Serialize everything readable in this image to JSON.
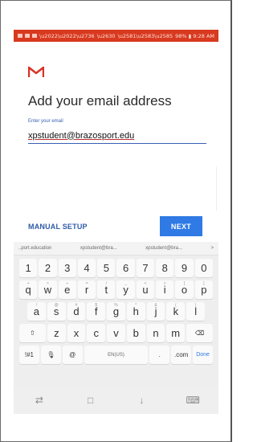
{
  "status_bar": {
    "left_text": "▣ ▢ ▤ ••",
    "right_text": "98% ▮ 9:28 AM",
    "color": "#d8391f"
  },
  "brand": {
    "icon": "gmail-icon",
    "color": "#d93025"
  },
  "title": "Add your email address",
  "email": {
    "label": "Enter your email",
    "value": "xpstudent@brazosport.edu"
  },
  "actions": {
    "manual_setup": "MANUAL SETUP",
    "next": "NEXT"
  },
  "keyboard": {
    "suggestions": [
      "..port.education",
      "xpstudent@bra...",
      "xpstudent@bra..."
    ],
    "suggestion_more": ">",
    "row_numbers": [
      "1",
      "2",
      "3",
      "4",
      "5",
      "6",
      "7",
      "8",
      "9",
      "0"
    ],
    "row_q": [
      {
        "k": "q",
        "s": "+"
      },
      {
        "k": "w",
        "s": "×"
      },
      {
        "k": "e",
        "s": "÷"
      },
      {
        "k": "r",
        "s": "="
      },
      {
        "k": "t",
        "s": "/"
      },
      {
        "k": "y",
        "s": "_"
      },
      {
        "k": "u",
        "s": "<"
      },
      {
        "k": "i",
        "s": ">"
      },
      {
        "k": "o",
        "s": "["
      },
      {
        "k": "p",
        "s": "]"
      }
    ],
    "row_a": [
      {
        "k": "a",
        "s": "!"
      },
      {
        "k": "s",
        "s": "@"
      },
      {
        "k": "d",
        "s": "#"
      },
      {
        "k": "f",
        "s": "$"
      },
      {
        "k": "g",
        "s": "%"
      },
      {
        "k": "h",
        "s": "^"
      },
      {
        "k": "j",
        "s": "&"
      },
      {
        "k": "k",
        "s": "("
      },
      {
        "k": "l",
        "s": ")"
      }
    ],
    "row_z": [
      "z",
      "x",
      "c",
      "v",
      "b",
      "n",
      "m"
    ],
    "shift": "⇧",
    "backspace": "⌫",
    "sym": "!#1",
    "mic": "🎙",
    "at": "@",
    "space": "EN(US)",
    "dot": ".",
    "dotcom": ".com",
    "done": "Done"
  },
  "nav": {
    "back": "⇄",
    "home": "□",
    "recents": "↓",
    "keyboard": "⌨"
  }
}
